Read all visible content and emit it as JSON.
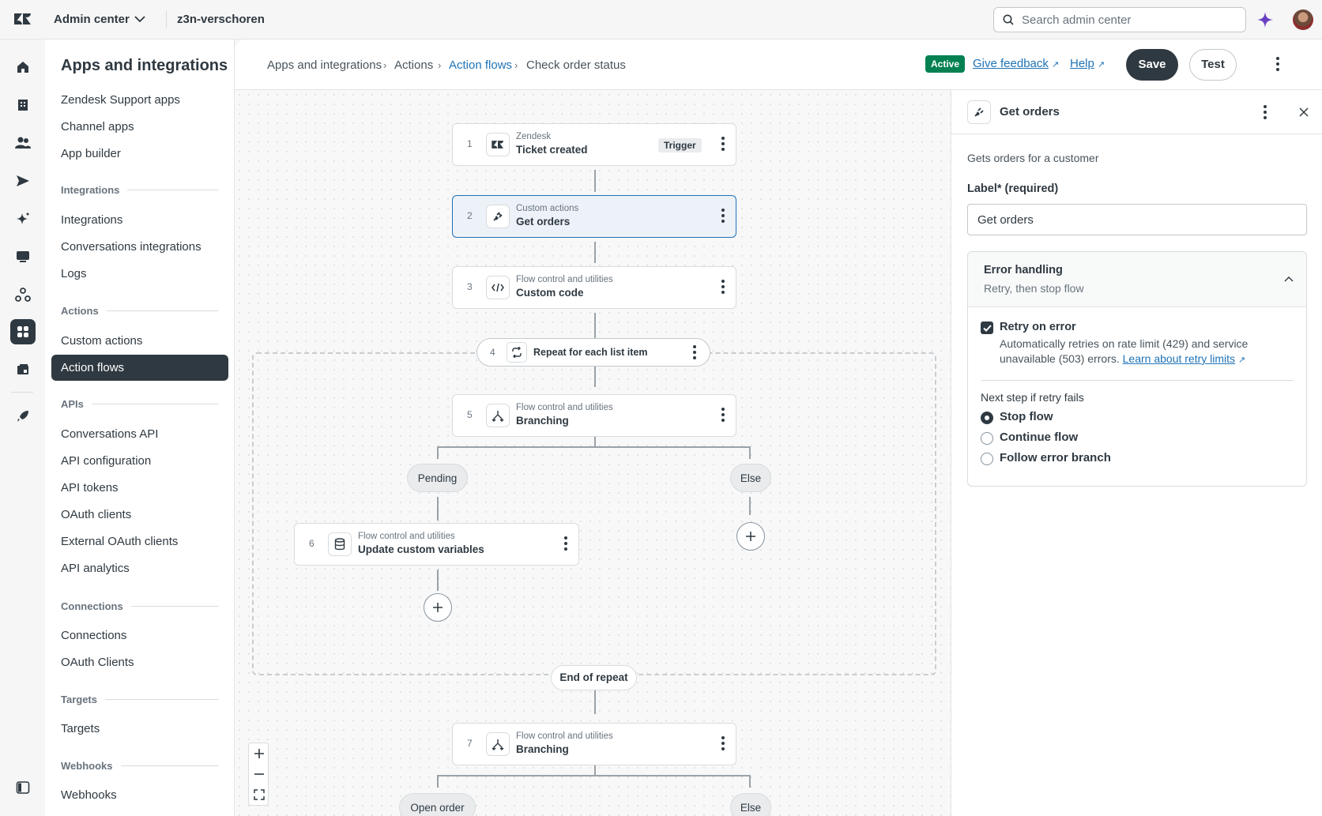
{
  "topbar": {
    "product": "Admin center",
    "account": "z3n-verschoren",
    "search_placeholder": "Search admin center"
  },
  "rail": {
    "icons": [
      "home-icon",
      "building-icon",
      "people-icon",
      "send-icon",
      "ai-sparkle-icon",
      "chat-icon",
      "objects-icon",
      "apps-icon",
      "workspaces-icon",
      "rocket-icon",
      "sidebar-toggle-icon"
    ]
  },
  "sidebar": {
    "title": "Apps and integrations",
    "top_items": [
      "Zendesk Support apps",
      "Channel apps",
      "App builder"
    ],
    "sections": [
      {
        "heading": "Integrations",
        "items": [
          "Integrations",
          "Conversations integrations",
          "Logs"
        ]
      },
      {
        "heading": "Actions",
        "items": [
          "Custom actions",
          "Action flows"
        ]
      },
      {
        "heading": "APIs",
        "items": [
          "Conversations API",
          "API configuration",
          "API tokens",
          "OAuth clients",
          "External OAuth clients",
          "API analytics"
        ]
      },
      {
        "heading": "Connections",
        "items": [
          "Connections",
          "OAuth Clients"
        ]
      },
      {
        "heading": "Targets",
        "items": [
          "Targets"
        ]
      },
      {
        "heading": "Webhooks",
        "items": [
          "Webhooks"
        ]
      }
    ],
    "active_item": "Action flows"
  },
  "header": {
    "breadcrumbs": [
      "Apps and integrations",
      "Actions",
      "Action flows",
      "Check order status"
    ],
    "status": "Active",
    "feedback_label": "Give feedback",
    "help_label": "Help",
    "save_label": "Save",
    "test_label": "Test"
  },
  "flow": {
    "nodes": [
      {
        "num": "1",
        "category": "Zendesk",
        "title": "Ticket created",
        "tag": "Trigger"
      },
      {
        "num": "2",
        "category": "Custom actions",
        "title": "Get orders"
      },
      {
        "num": "3",
        "category": "Flow control and utilities",
        "title": "Custom code"
      },
      {
        "num": "4",
        "title": "Repeat for each list item"
      },
      {
        "num": "5",
        "category": "Flow control and utilities",
        "title": "Branching"
      },
      {
        "num": "6",
        "category": "Flow control and utilities",
        "title": "Update custom variables"
      },
      {
        "num": "7",
        "category": "Flow control and utilities",
        "title": "Branching"
      }
    ],
    "branches_1": [
      "Pending",
      "Else"
    ],
    "branches_2": [
      "Open order",
      "Else"
    ],
    "end_repeat": "End of repeat"
  },
  "panel": {
    "title": "Get orders",
    "description": "Gets orders for a customer",
    "label_field_label": "Label* (required)",
    "label_value": "Get orders",
    "error_handling": {
      "title": "Error handling",
      "summary": "Retry, then stop flow",
      "retry_label": "Retry on error",
      "retry_checked": true,
      "retry_desc": "Automatically retries on rate limit (429) and service unavailable (503) errors.",
      "retry_link": "Learn about retry limits",
      "next_step_label": "Next step if retry fails",
      "options": [
        "Stop flow",
        "Continue flow",
        "Follow error branch"
      ],
      "selected": "Stop flow"
    }
  },
  "colors": {
    "accent": "#1f73b7",
    "dark": "#2f3941",
    "active_green": "#038153"
  }
}
